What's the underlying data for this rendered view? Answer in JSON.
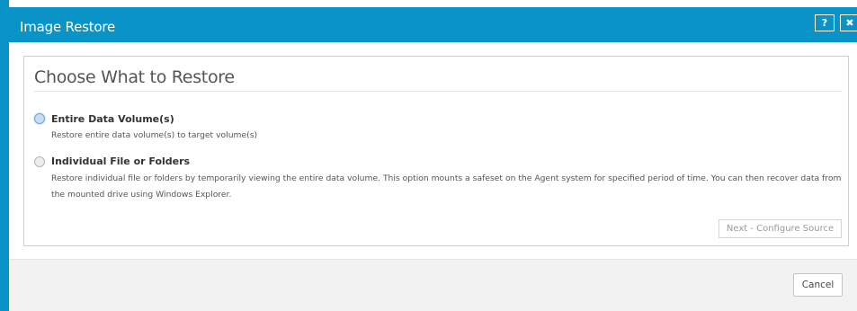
{
  "window": {
    "title": "Image Restore",
    "help_label": "?",
    "close_label": "✖"
  },
  "section": {
    "title": "Choose What to Restore"
  },
  "options": [
    {
      "label": "Entire Data Volume(s)",
      "description": "Restore entire data volume(s) to target volume(s)",
      "selected": true
    },
    {
      "label": "Individual File or Folders",
      "description": "Restore individual file or folders by temporarily viewing the entire data volume. This option mounts a safeset on the Agent system for specified period of time. You can then recover data from the mounted drive using Windows Explorer.",
      "selected": false
    }
  ],
  "buttons": {
    "next": "Next - Configure Source",
    "cancel": "Cancel"
  },
  "colors": {
    "accent": "#0a93c7"
  }
}
